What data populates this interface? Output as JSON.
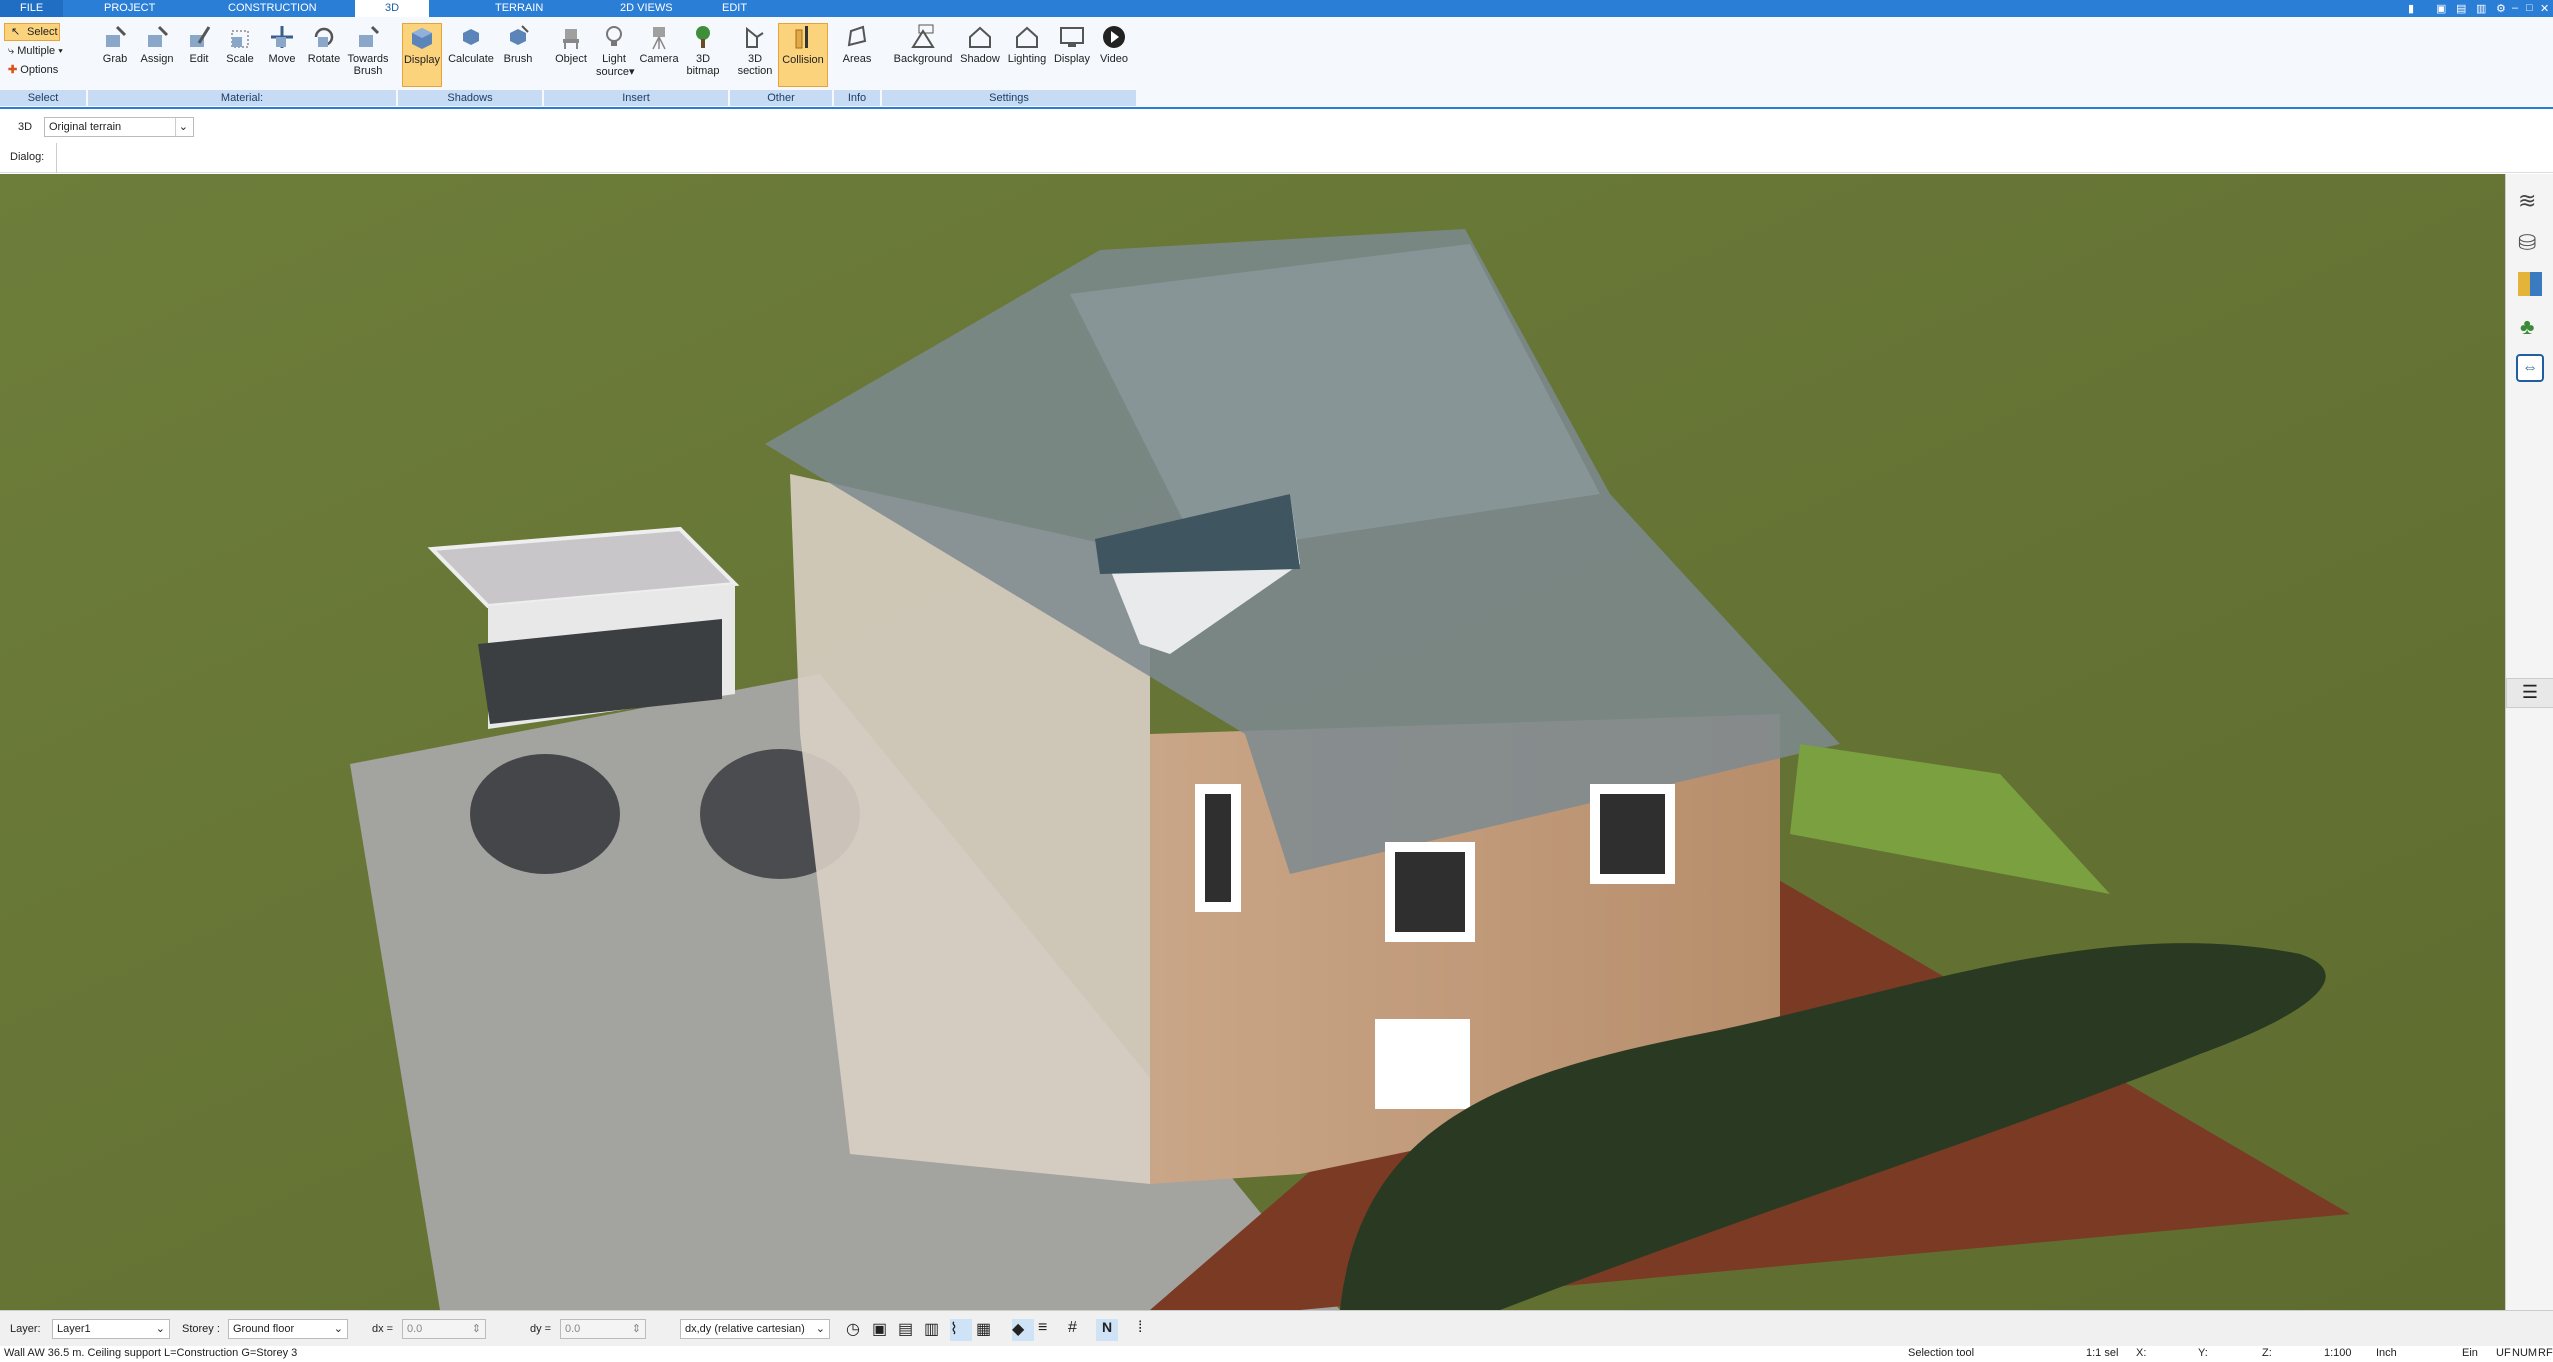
{
  "menu": {
    "tabs": [
      "FILE",
      "PROJECT",
      "CONSTRUCTION",
      "3D",
      "TERRAIN",
      "2D VIEWS",
      "EDIT"
    ],
    "active_tab": "3D"
  },
  "ribbon": {
    "select_group": {
      "select": "Select",
      "multiple": "Multiple",
      "options": "Options",
      "label": "Select"
    },
    "material_group": {
      "label": "Material:",
      "buttons": [
        "Grab",
        "Assign",
        "Edit",
        "Scale",
        "Move",
        "Rotate",
        "Towards",
        "Brush"
      ]
    },
    "shadows_group": {
      "label": "Shadows",
      "buttons": [
        "Display",
        "Calculate",
        "Brush"
      ]
    },
    "insert_group": {
      "label": "Insert",
      "buttons": [
        "Object",
        "Light",
        "source",
        "Camera",
        "3D",
        "bitmap"
      ]
    },
    "other_group": {
      "label": "Other",
      "buttons": [
        "3D",
        "section",
        "Collision"
      ]
    },
    "info_group": {
      "label": "Info",
      "buttons": [
        "Areas"
      ]
    },
    "settings_group": {
      "label": "Settings",
      "buttons": [
        "Background",
        "Shadow",
        "Lighting",
        "Display",
        "Video"
      ]
    }
  },
  "section": {
    "mode": "3D",
    "terrain_select": "Original terrain"
  },
  "dialog": {
    "label": "Dialog:"
  },
  "statusbar": {
    "layer_label": "Layer:",
    "layer_value": "Layer1",
    "storey_label": "Storey :",
    "storey_value": "Ground floor",
    "dx_label": "dx =",
    "dx_value": "0.0",
    "dy_label": "dy =",
    "dy_value": "0.0",
    "coord_mode": "dx,dy (relative cartesian)"
  },
  "footer": {
    "info": "Wall AW 36.5 m. Ceiling support L=Construction G=Storey 3",
    "tool": "Selection tool",
    "sel": "1:1 sel",
    "x": "X:",
    "y": "Y:",
    "z": "Z:",
    "scale": "1:100",
    "unit": "Inch",
    "ein": "Ein",
    "uf": "UF",
    "num": "NUM",
    "rf": "RF"
  },
  "colors": {
    "accent": "#2b7ed6",
    "grass": "#6b7a36",
    "active": "#fbd37d"
  }
}
